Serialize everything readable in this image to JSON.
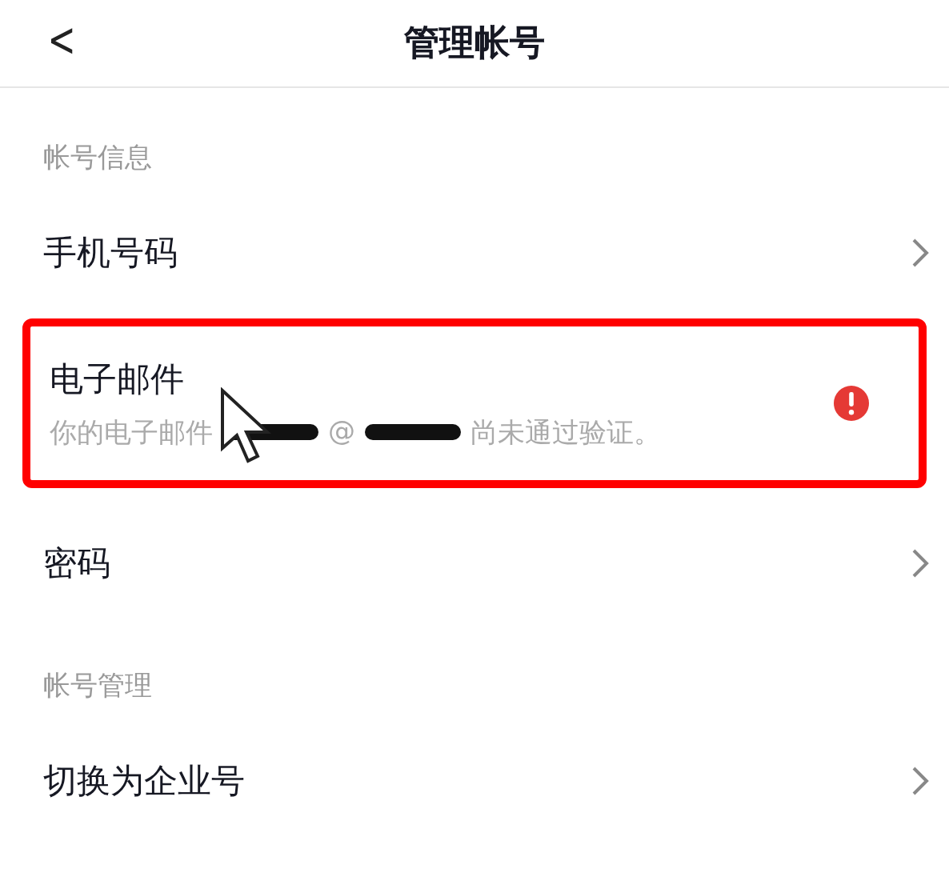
{
  "header": {
    "back": "<",
    "title": "管理帐号"
  },
  "sections": [
    {
      "label": "帐号信息",
      "rows": [
        {
          "kind": "link",
          "title": "手机号码",
          "highlighted": false
        },
        {
          "kind": "alert",
          "title": "电子邮件",
          "note_parts": [
            "你的电子邮件",
            "@",
            "尚未通过验证。"
          ],
          "highlighted": true
        },
        {
          "kind": "link",
          "title": "密码",
          "highlighted": false
        }
      ]
    },
    {
      "label": "帐号管理",
      "rows": [
        {
          "kind": "link",
          "title": "切换为企业号",
          "highlighted": false
        }
      ]
    }
  ]
}
